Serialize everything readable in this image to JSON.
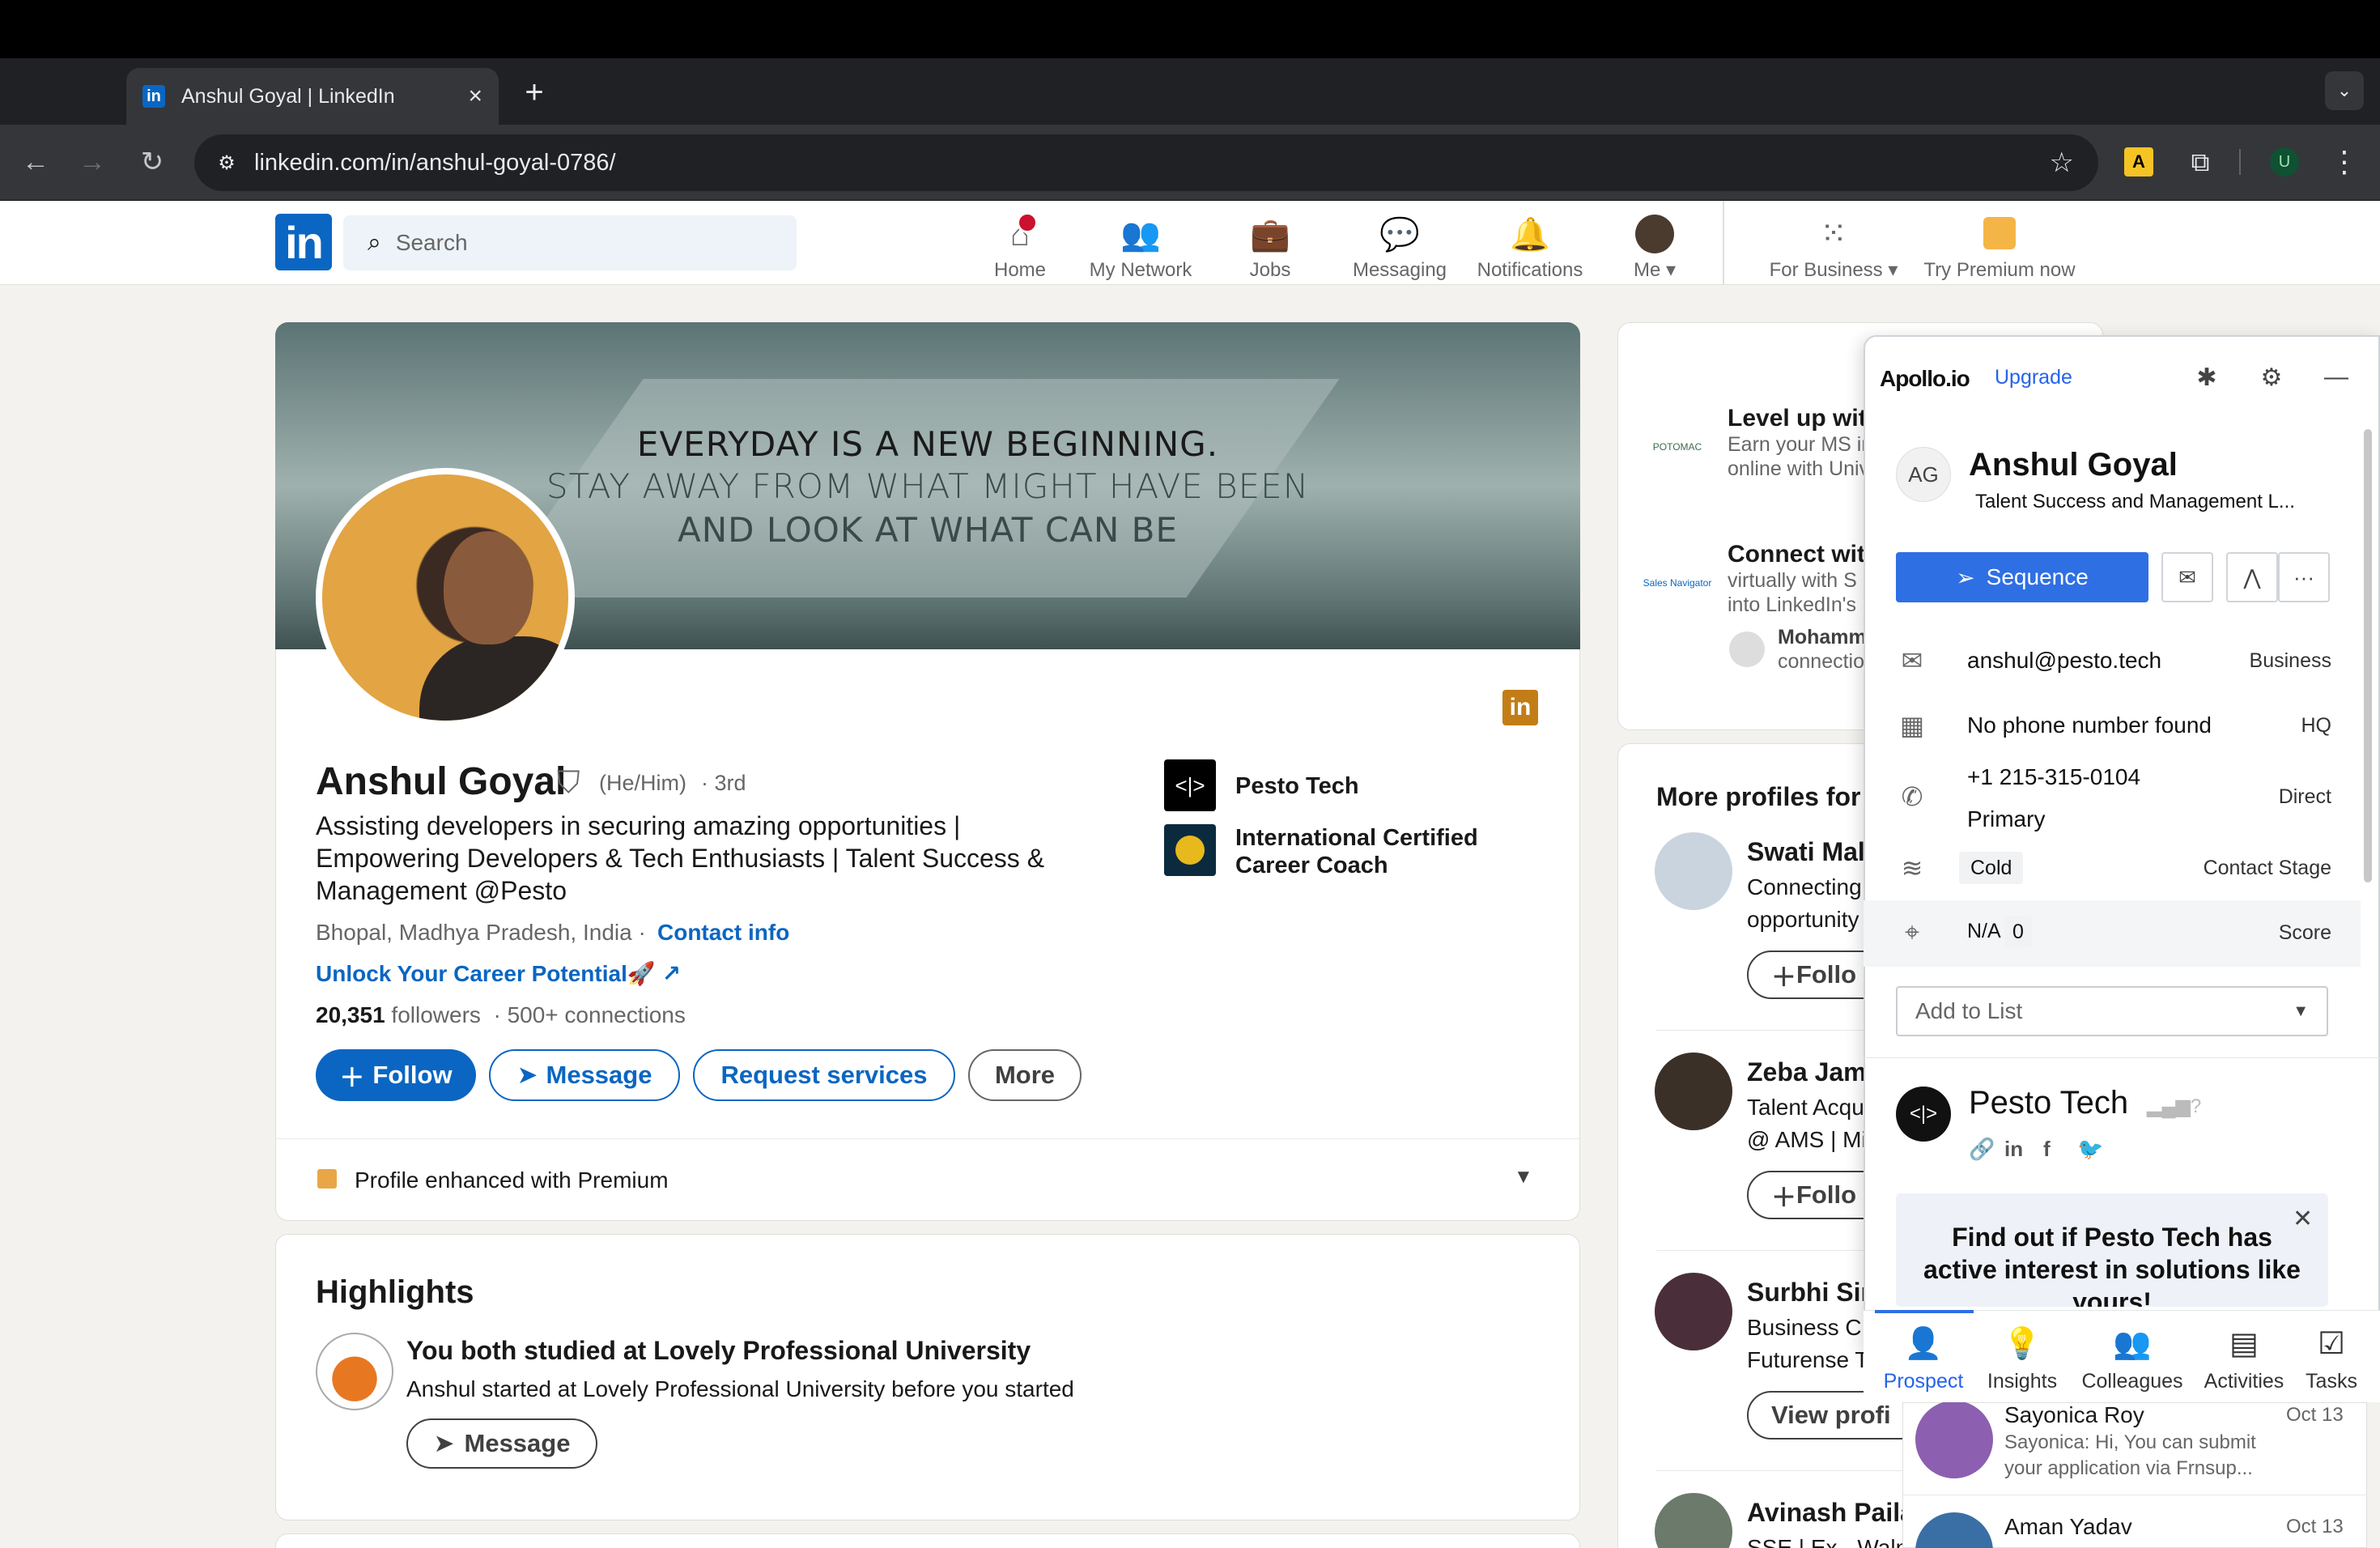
{
  "browser": {
    "tab_title": "Anshul Goyal | LinkedIn",
    "url": "linkedin.com/in/anshul-goyal-0786/",
    "profile_initial": "U"
  },
  "linkedin_header": {
    "search_placeholder": "Search",
    "nav": {
      "home": "Home",
      "network": "My Network",
      "jobs": "Jobs",
      "messaging": "Messaging",
      "notifications": "Notifications",
      "me": "Me",
      "business": "For Business",
      "premium": "Try Premium now"
    }
  },
  "profile": {
    "cover_lines": [
      "EVERYDAY IS A NEW BEGINNING.",
      "STAY AWAY FROM WHAT MIGHT HAVE BEEN",
      "AND LOOK AT WHAT CAN BE"
    ],
    "name": "Anshul Goyal",
    "pronouns": "(He/Him)",
    "degree": "· 3rd",
    "headline": "Assisting developers in securing amazing opportunities | Empowering Developers & Tech Enthusiasts | Talent Success & Management @Pesto",
    "location": "Bhopal, Madhya Pradesh, India ·",
    "contact_info": "Contact info",
    "link": "Unlock Your Career Potential🚀",
    "followers_count": "20,351",
    "followers_label": "followers",
    "connections": "· 500+ connections",
    "buttons": {
      "follow": "Follow",
      "message": "Message",
      "request": "Request services",
      "more": "More"
    },
    "experience": [
      {
        "name": "Pesto Tech"
      },
      {
        "name": "International Certified Career Coach"
      }
    ],
    "premium_enhanced": "Profile enhanced with Premium"
  },
  "highlights": {
    "title": "Highlights",
    "main": "You both studied at Lovely Professional University",
    "sub": "Anshul started at Lovely Professional University before you started",
    "button": "Message"
  },
  "right_ads": [
    {
      "title": "Level up with",
      "desc1": "Earn your MS in",
      "desc2": "online with Univ",
      "logo_text": "POTOMAC"
    },
    {
      "title": "Connect with",
      "desc1": "virtually with S",
      "desc2": "into LinkedIn's",
      "logo_text": "Sales Navigator",
      "person": "Mohamm",
      "person_sub": "connectio"
    }
  ],
  "more_profiles": {
    "title": "More profiles for",
    "items": [
      {
        "name": "Swati Mal",
        "line1": "Connecting",
        "line2": "opportunity",
        "button": "Follo"
      },
      {
        "name": "Zeba Jam",
        "line1": "Talent Acqu",
        "line2": "@ AMS | Mi",
        "button": "Follo"
      },
      {
        "name": "Surbhi Sir",
        "line1": "Business C",
        "line2": "Futurense T",
        "button": "View profi"
      },
      {
        "name": "Avinash Paila",
        "line1": "SSE | Ex - Walm",
        "line2": "",
        "button": ""
      }
    ]
  },
  "apollo": {
    "logo": "Apollo.io",
    "upgrade": "Upgrade",
    "avatar_initials": "AG",
    "name": "Anshul Goyal",
    "title": "Talent Success and Management L...",
    "sequence": "Sequence",
    "email": "anshul@pesto.tech",
    "email_tag": "Business",
    "hq_phone": "No phone number found",
    "hq_tag": "HQ",
    "direct_phone": "+1 215-315-0104",
    "direct_sub": "Primary",
    "direct_tag": "Direct",
    "stage_value": "Cold",
    "stage_tag": "Contact Stage",
    "score_na": "N/A",
    "score_value": "0",
    "score_tag": "Score",
    "add_to_list": "Add to List",
    "company": "Pesto Tech",
    "banner": "Find out if Pesto Tech has active interest in solutions like yours!",
    "tabs": [
      "Prospect",
      "Insights",
      "Colleagues",
      "Activities",
      "Tasks"
    ]
  },
  "messages": [
    {
      "name": "Sayonica Roy",
      "date": "Oct 13",
      "text1": "Sayonica: Hi, You can submit",
      "text2": "your application via Frnsup..."
    },
    {
      "name": "Aman Yadav",
      "date": "Oct 13",
      "text1": "",
      "text2": ""
    }
  ]
}
